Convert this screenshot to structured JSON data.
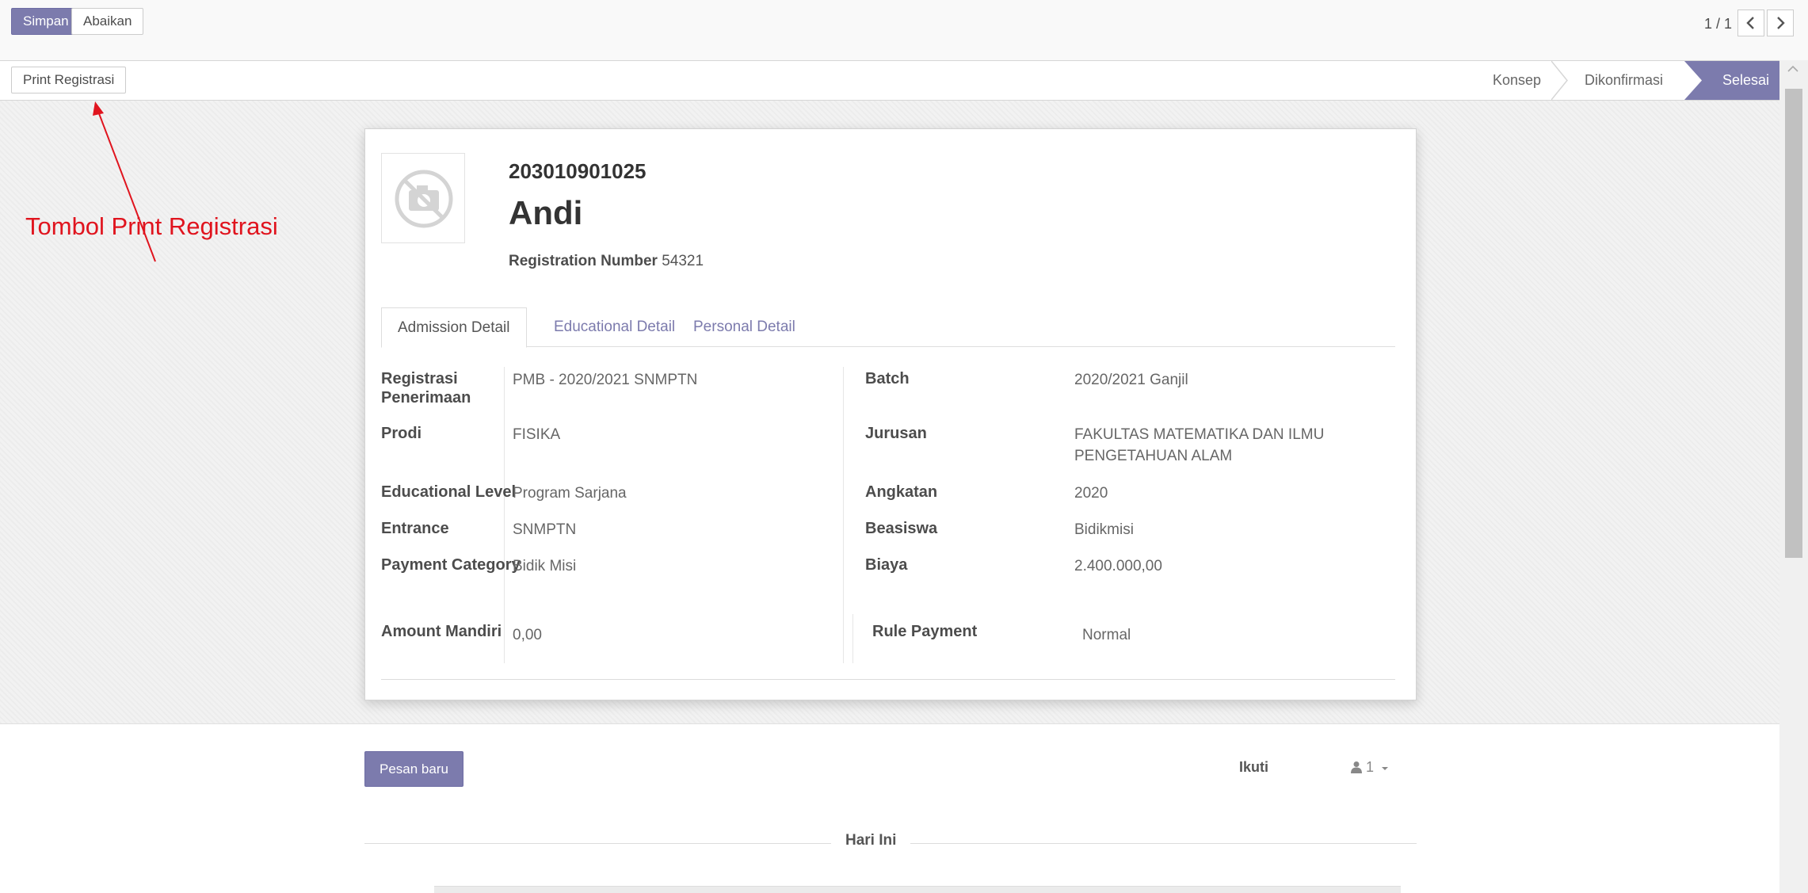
{
  "toolbar": {
    "save_label": "Simpan",
    "discard_label": "Abaikan",
    "pager_value": "1 / 1",
    "pager_prev_icon": "chevron-left-icon",
    "pager_next_icon": "chevron-right-icon"
  },
  "statusbar": {
    "print_label": "Print Registrasi",
    "stages": [
      {
        "label": "Konsep",
        "active": false
      },
      {
        "label": "Dikonfirmasi",
        "active": false
      },
      {
        "label": "Selesai",
        "active": true
      }
    ]
  },
  "record": {
    "student_number": "203010901025",
    "name": "Andi",
    "registration_label": "Registration Number",
    "registration_number": "54321",
    "avatar_icon": "camera-off-icon"
  },
  "tabs": [
    {
      "label": "Admission Detail",
      "active": true
    },
    {
      "label": "Educational Detail",
      "active": false
    },
    {
      "label": "Personal Detail",
      "active": false
    }
  ],
  "admission": {
    "registrasi_label": "Registrasi Penerimaan",
    "registrasi_value": "PMB - 2020/2021 SNMPTN",
    "batch_label": "Batch",
    "batch_value": "2020/2021 Ganjil",
    "prodi_label": "Prodi",
    "prodi_value": "FISIKA",
    "jurusan_label": "Jurusan",
    "jurusan_value": "FAKULTAS MATEMATIKA DAN ILMU PENGETAHUAN ALAM",
    "level_label": "Educational Level",
    "level_value": "Program Sarjana",
    "angkatan_label": "Angkatan",
    "angkatan_value": "2020",
    "entrance_label": "Entrance",
    "entrance_value": "SNMPTN",
    "beasiswa_label": "Beasiswa",
    "beasiswa_value": "Bidikmisi",
    "payment_category_label": "Payment Category",
    "payment_category_value": "Bidik Misi",
    "biaya_label": "Biaya",
    "biaya_value": "2.400.000,00",
    "amount_mandiri_label": "Amount Mandiri",
    "amount_mandiri_value": "0,00",
    "rule_payment_label": "Rule Payment",
    "rule_payment_value": "Normal"
  },
  "chatter": {
    "new_message_label": "Pesan baru",
    "follow_label": "Ikuti",
    "followers_count": "1",
    "followers_icon": "user-icon",
    "date_separator": "Hari Ini"
  },
  "annotation": {
    "text": "Tombol Print Registrasi",
    "color": "#e0141e"
  },
  "colors": {
    "primary": "#7c7bad",
    "annotation": "#e0141e"
  }
}
